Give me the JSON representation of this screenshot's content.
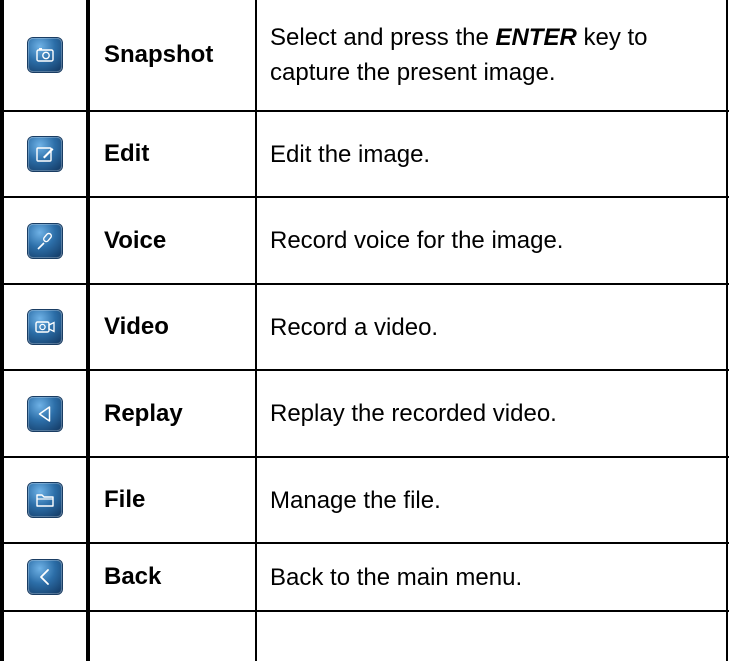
{
  "rows": [
    {
      "icon": "camera-icon",
      "name": "Snapshot",
      "desc_pre": "Select and press the ",
      "desc_key": "ENTER",
      "desc_post": " key to capture the present image."
    },
    {
      "icon": "edit-icon",
      "name": "Edit",
      "desc": "Edit the image."
    },
    {
      "icon": "microphone-icon",
      "name": "Voice",
      "desc": "Record voice for the image."
    },
    {
      "icon": "video-camera-icon",
      "name": "Video",
      "desc": "Record a video."
    },
    {
      "icon": "play-left-icon",
      "name": "Replay",
      "desc": "Replay the recorded video."
    },
    {
      "icon": "folder-icon",
      "name": "File",
      "desc": "Manage the file."
    },
    {
      "icon": "back-icon",
      "name": "Back",
      "desc": "Back to the main menu."
    }
  ]
}
